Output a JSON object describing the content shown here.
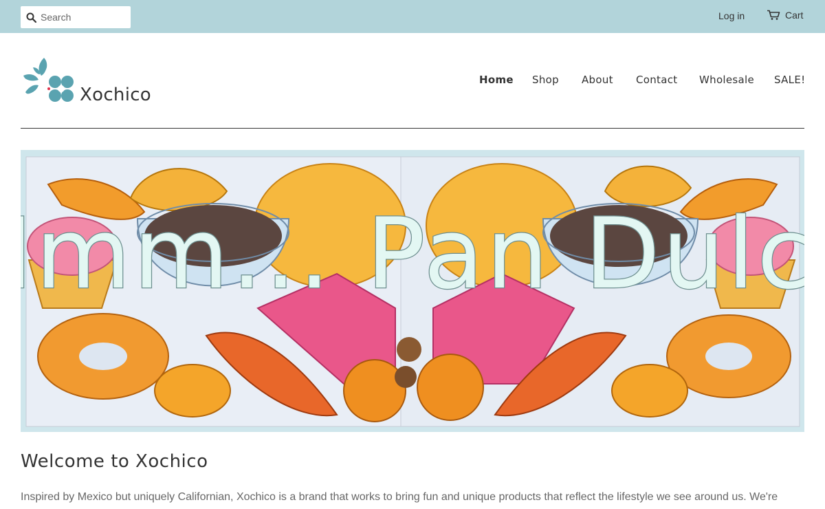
{
  "topbar": {
    "search_placeholder": "Search",
    "login_label": "Log in",
    "cart_label": "Cart",
    "background_color": "#b2d4da"
  },
  "header": {
    "brand": "Xochico",
    "logo_colors": [
      "#5aa3b0",
      "#e0324b"
    ]
  },
  "nav": {
    "items": [
      {
        "label": "Home",
        "active": true
      },
      {
        "label": "Shop",
        "active": false
      },
      {
        "label": "About",
        "active": false
      },
      {
        "label": "Contact",
        "active": false
      },
      {
        "label": "Wholesale",
        "active": false
      },
      {
        "label": "SALE!",
        "active": false
      }
    ]
  },
  "hero": {
    "banner_text": "Mmm... Pan Dulce",
    "icons": [
      "cupcake",
      "concha",
      "coffee-cup",
      "donut",
      "croissant",
      "empanada"
    ]
  },
  "main": {
    "heading": "Welcome to Xochico",
    "intro": "Inspired by Mexico but uniquely Californian, Xochico is a brand that works to bring fun and unique products that reflect the lifestyle we see around us.  We're"
  }
}
